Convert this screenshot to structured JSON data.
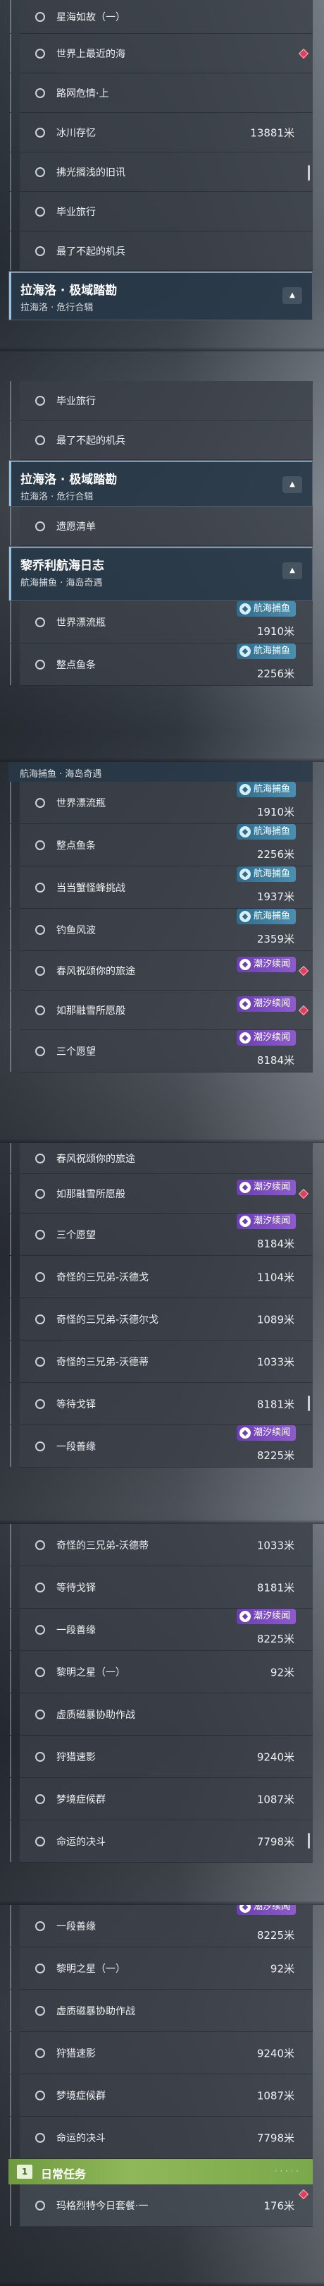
{
  "quests": {
    "q1": {
      "title": "星海如故（一）"
    },
    "q2": {
      "title": "世界上最近的海"
    },
    "q3": {
      "title": "路网危情·上"
    },
    "q4": {
      "title": "冰川存忆",
      "distance": "13881米"
    },
    "q5": {
      "title": "拂光搁浅的旧讯"
    },
    "q6": {
      "title": "毕业旅行"
    },
    "q7": {
      "title": "最了不起的机兵"
    },
    "q8": {
      "title": "遗愿清单"
    },
    "q9": {
      "title": "世界漂流瓶",
      "distance": "1910米"
    },
    "q10": {
      "title": "整点鱼条",
      "distance": "2256米"
    },
    "q11": {
      "title": "当当蟹怪蜂挑战",
      "distance": "1937米"
    },
    "q12": {
      "title": "钓鱼风波",
      "distance": "2359米"
    },
    "q13": {
      "title": "春风祝颂你的旅途"
    },
    "q14": {
      "title": "如那融雪所愿般"
    },
    "q15": {
      "title": "三个愿望",
      "distance": "8184米"
    },
    "q16": {
      "title": "奇怪的三兄弟-沃德戈",
      "distance": "1104米"
    },
    "q17": {
      "title": "奇怪的三兄弟-沃德尔戈",
      "distance": "1089米"
    },
    "q18": {
      "title": "奇怪的三兄弟-沃德蒂",
      "distance": "1033米"
    },
    "q19": {
      "title": "等待戈铎",
      "distance": "8181米"
    },
    "q20": {
      "title": "一段善缘",
      "distance": "8225米"
    },
    "q21": {
      "title": "黎明之星（一）",
      "distance": "92米"
    },
    "q22": {
      "title": "虚质磁暴协助作战"
    },
    "q23": {
      "title": "狩猎速影",
      "distance": "9240米"
    },
    "q24": {
      "title": "梦境症候群",
      "distance": "1087米"
    },
    "q25": {
      "title": "命运的决斗",
      "distance": "7798米"
    },
    "q26": {
      "title": "玛格烈特今日套餐·一",
      "distance": "176米"
    }
  },
  "groups": {
    "lahai": {
      "title": "拉海洛 · 极域踏勘",
      "subtitle": "拉海洛 · 危行合辑"
    },
    "lizhao": {
      "title": "黎乔利航海日志",
      "subtitle": "航海捕鱼 · 海岛奇遇"
    }
  },
  "badges": {
    "tide": "潮汐续闻",
    "fish": "航海捕鱼"
  },
  "daily": {
    "num": "1",
    "title": "日常任务"
  },
  "colors": {
    "tide": "#7a4cc2",
    "fish": "#3d7fa0",
    "daily": "#86b050",
    "pin": "#e0415a"
  }
}
